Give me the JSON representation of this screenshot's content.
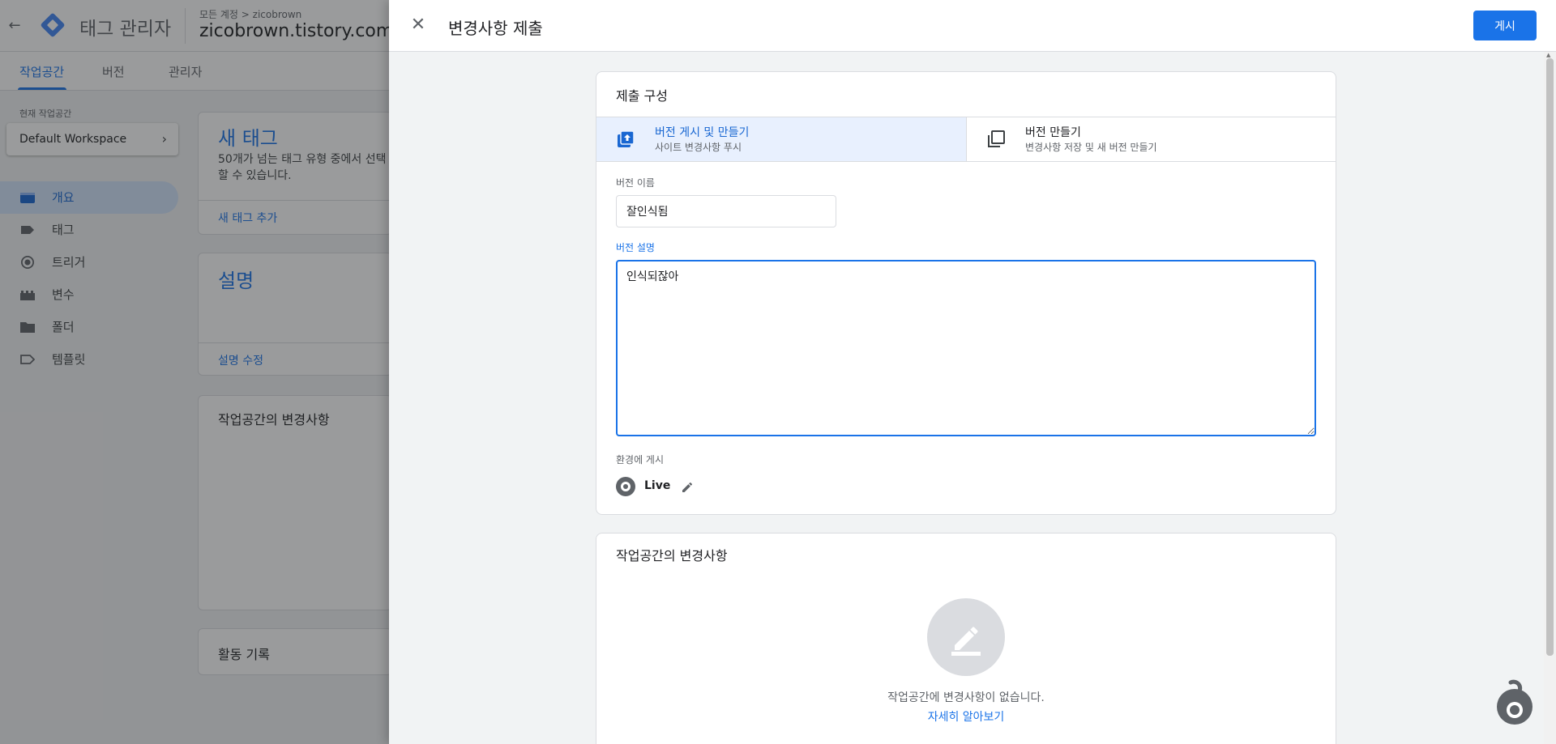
{
  "background": {
    "app_title": "태그 관리자",
    "breadcrumb": "모든 계정 > zicobrown",
    "account_name": "zicobrown.tistory.com",
    "tabs": [
      {
        "label": "작업공간",
        "active": true
      },
      {
        "label": "버전",
        "active": false
      },
      {
        "label": "관리자",
        "active": false
      }
    ],
    "workspace_label": "현재 작업공간",
    "workspace_name": "Default Workspace",
    "nav": [
      {
        "label": "개요",
        "icon": "overview-icon",
        "active": true
      },
      {
        "label": "태그",
        "icon": "tag-icon",
        "active": false
      },
      {
        "label": "트리거",
        "icon": "trigger-icon",
        "active": false
      },
      {
        "label": "변수",
        "icon": "variable-icon",
        "active": false
      },
      {
        "label": "폴더",
        "icon": "folder-icon",
        "active": false
      },
      {
        "label": "템플릿",
        "icon": "template-icon",
        "active": false
      }
    ],
    "cards": {
      "new_tag_title": "새 태그",
      "new_tag_text": "50개가 넘는 태그 유형 중에서 선택\n할 수 있습니다.",
      "new_tag_link": "새 태그 추가",
      "description_title": "설명",
      "description_link": "설명 수정",
      "changes_title": "작업공간의 변경사항",
      "activity_title": "활동 기록"
    }
  },
  "sheet": {
    "title": "변경사항 제출",
    "publish_button": "게시",
    "config_title": "제출 구성",
    "options": [
      {
        "title": "버전 게시 및 만들기",
        "subtitle": "사이트 변경사항 푸시",
        "selected": true,
        "icon": "publish-upload-icon"
      },
      {
        "title": "버전 만들기",
        "subtitle": "변경사항 저장 및 새 버전 만들기",
        "selected": false,
        "icon": "copy-version-icon"
      }
    ],
    "version_name_label": "버전 이름",
    "version_name_value": "잘인식됨",
    "version_desc_label": "버전 설명",
    "version_desc_value": "인식되잖아",
    "env_label": "환경에 게시",
    "env_name": "Live",
    "changes_title": "작업공간의 변경사항",
    "empty_text": "작업공간에 변경사항이 없습니다.",
    "learn_more": "자세히 알아보기"
  },
  "colors": {
    "accent": "#1a73e8",
    "selected_bg": "#e8f0fe",
    "scrim": "rgba(32,33,36,0.45)"
  }
}
